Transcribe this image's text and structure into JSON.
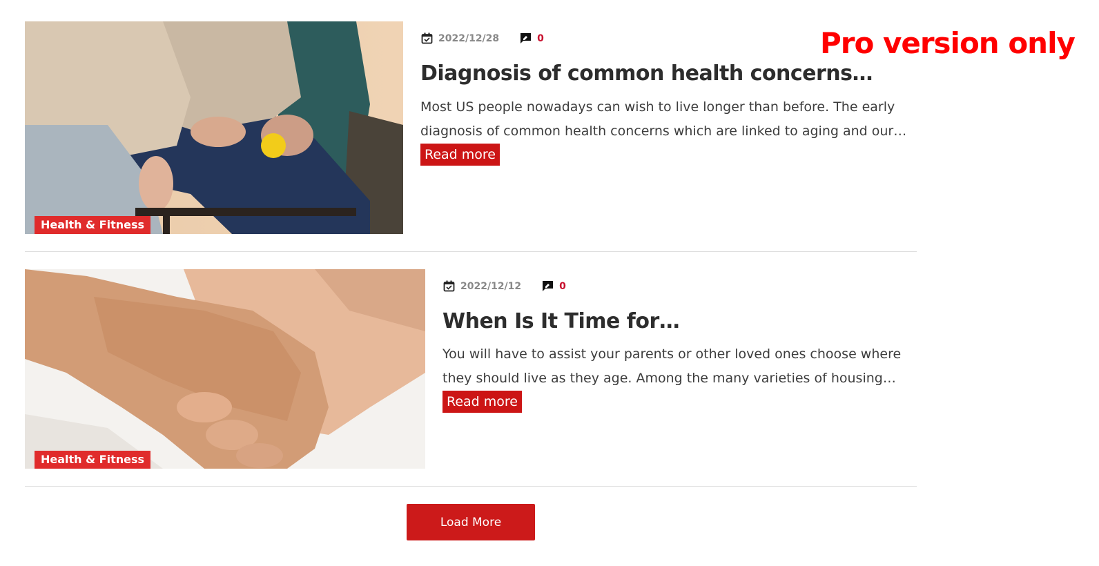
{
  "pro_notice": "Pro version only",
  "posts": [
    {
      "category": "Health & Fitness",
      "date": "2022/12/28",
      "comments": "0",
      "title": "Diagnosis of common health concerns…",
      "excerpt": "Most US people nowadays can wish to live longer than before. The early diagnosis of common health concerns which are linked to aging and our…",
      "read_more": "Read more",
      "image": "elderly-hands-holding-stress-ball-photo"
    },
    {
      "category": "Health & Fitness",
      "date": "2022/12/12",
      "comments": "0",
      "title": "When Is It Time for…",
      "excerpt": "You will have to assist your parents or other loved ones choose where they should live as they age. Among the many varieties of housing…",
      "read_more": "Read more",
      "image": "holding-elderly-hand-photo"
    }
  ],
  "load_more": "Load More",
  "colors": {
    "accent": "#cc1515",
    "badge": "#e02b2b",
    "pro_notice": "#ff0000",
    "comment_count": "#c8102e"
  }
}
